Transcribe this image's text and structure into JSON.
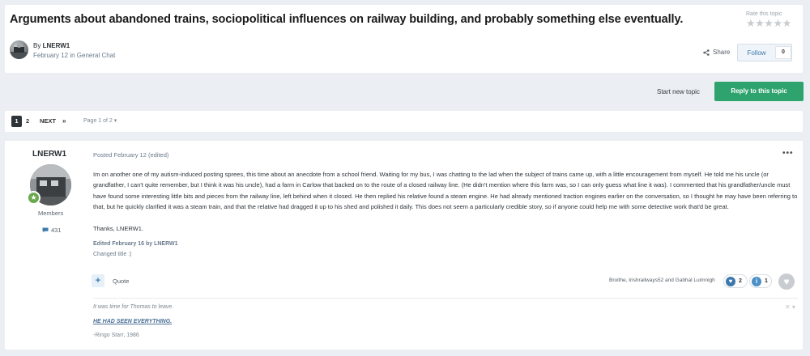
{
  "topic": {
    "title": "Arguments about abandoned trains, sociopolitical influences on railway building, and probably something else eventually.",
    "rate_label": "Rate this topic",
    "stars": "★★★★★",
    "by_prefix": "By ",
    "author": "LNERW1",
    "date_line": "February 12 in General Chat",
    "share_label": "Share",
    "follow_label": "Follow",
    "follow_count": "0"
  },
  "actions": {
    "start_new_topic": "Start new topic",
    "reply": "Reply to this topic"
  },
  "pagination": {
    "page_1": "1",
    "page_2": "2",
    "next": "NEXT",
    "last": "»",
    "page_of": "Page 1 of 2 ▾"
  },
  "post": {
    "author": "LNERW1",
    "group": "Members",
    "post_count": "431",
    "meta": "Posted February 12 (edited)",
    "menu": "•••",
    "body": "Im on another one of my autism-induced posting sprees, this time about an anecdote from a school friend. Waiting for my bus, I was chatting to the lad when the subject of trains came up, with a little encouragement from myself. He told me his uncle (or grandfather, I can't quite remember, but I think it was his uncle), had a farm in Carlow that backed on to the route of a closed railway line. (He didn't mention where this farm was, so I can only guess what line it was). I commented that his grandfather/uncle must have found some interesting little bits and pieces from the railway line, left behind when it closed. He then replied his relative found a steam engine. He had already mentioned traction engines earlier on the conversation, so I thought he may have been referring to that, but he quickly clarified it was a steam train, and that the relative had dragged it up to his shed and polished it daily. This does not seem a particularly credible story, so if anyone could help me with some detective work that'd be great.",
    "thanks": "Thanks, LNERW1.",
    "edited_by": "Edited February 16 by LNERW1",
    "edit_reason": "Changed title :)",
    "quote_plus": "+",
    "quote_label": "Quote",
    "reacted_by": "Broithe, Irishrailways52 and Gabhal Luimnigh",
    "reaction_like_count": "2",
    "reaction_info_count": "1"
  },
  "signature": {
    "line1": "It was time for Thomas to leave.",
    "line2": "HE HAD SEEN EVERYTHING.",
    "line3": "-Ringo Starr, 1986",
    "close": "✕ ▾"
  },
  "colors": {
    "accent_green": "#2ea36e",
    "link_blue": "#3d78ad",
    "pager_active": "#2f3438"
  }
}
